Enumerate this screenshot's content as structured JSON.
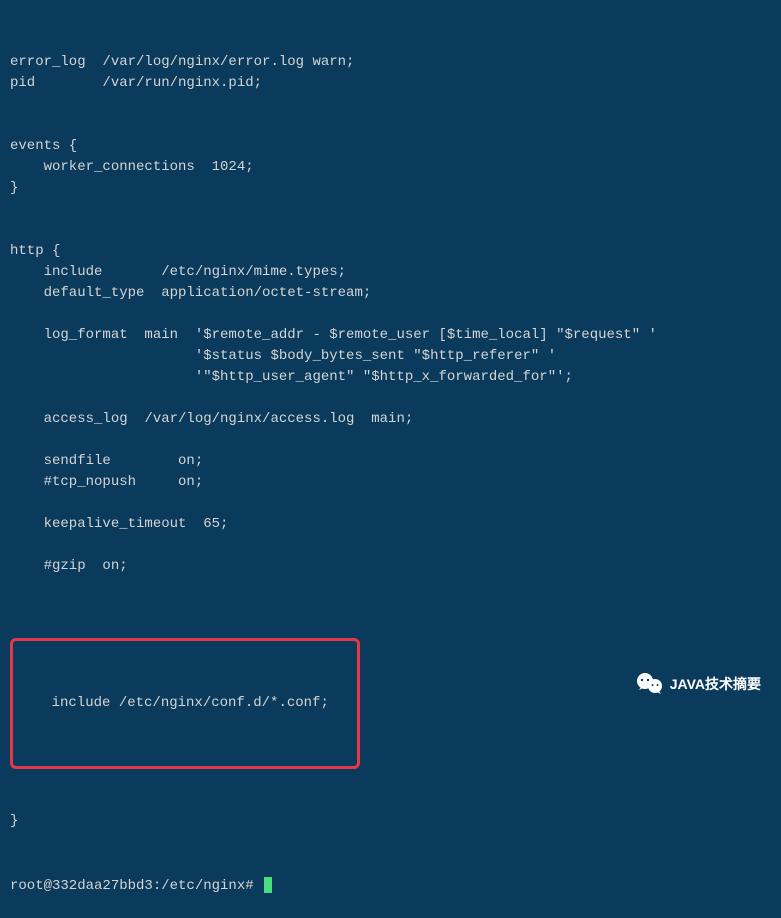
{
  "config": {
    "lines": [
      "error_log  /var/log/nginx/error.log warn;",
      "pid        /var/run/nginx.pid;",
      "",
      "",
      "events {",
      "    worker_connections  1024;",
      "}",
      "",
      "",
      "http {",
      "    include       /etc/nginx/mime.types;",
      "    default_type  application/octet-stream;",
      "",
      "    log_format  main  '$remote_addr - $remote_user [$time_local] \"$request\" '",
      "                      '$status $body_bytes_sent \"$http_referer\" '",
      "                      '\"$http_user_agent\" \"$http_x_forwarded_for\"';",
      "",
      "    access_log  /var/log/nginx/access.log  main;",
      "",
      "    sendfile        on;",
      "    #tcp_nopush     on;",
      "",
      "    keepalive_timeout  65;",
      "",
      "    #gzip  on;",
      ""
    ],
    "highlighted_line": "    include /etc/nginx/conf.d/*.conf;",
    "closing_brace": "}"
  },
  "prompt": "root@332daa27bbd3:/etc/nginx# ",
  "watermark_text": "JAVA技术摘要"
}
